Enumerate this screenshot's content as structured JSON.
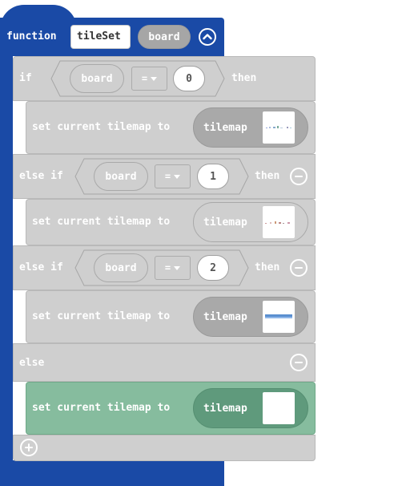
{
  "function_block": {
    "keyword": "function",
    "name": "tileSet",
    "param": "board"
  },
  "if_block": {
    "if_label": "if",
    "then_label": "then",
    "else_if_label": "else if",
    "else_label": "else"
  },
  "conditions": [
    {
      "variable": "board",
      "operator": "=",
      "value": "0"
    },
    {
      "variable": "board",
      "operator": "=",
      "value": "1"
    },
    {
      "variable": "board",
      "operator": "=",
      "value": "2"
    }
  ],
  "statements": [
    {
      "label": "set current tilemap to",
      "arg": "tilemap"
    },
    {
      "label": "set current tilemap to",
      "arg": "tilemap"
    },
    {
      "label": "set current tilemap to",
      "arg": "tilemap"
    },
    {
      "label": "set current tilemap to",
      "arg": "tilemap"
    }
  ],
  "colors": {
    "function": "#1a4aa6",
    "block": "#cfcfcf",
    "selected": "#86bc9e"
  },
  "icons": {
    "collapse": "chevron-up-icon",
    "remove": "minus-circle-icon",
    "add": "plus-circle-icon"
  }
}
